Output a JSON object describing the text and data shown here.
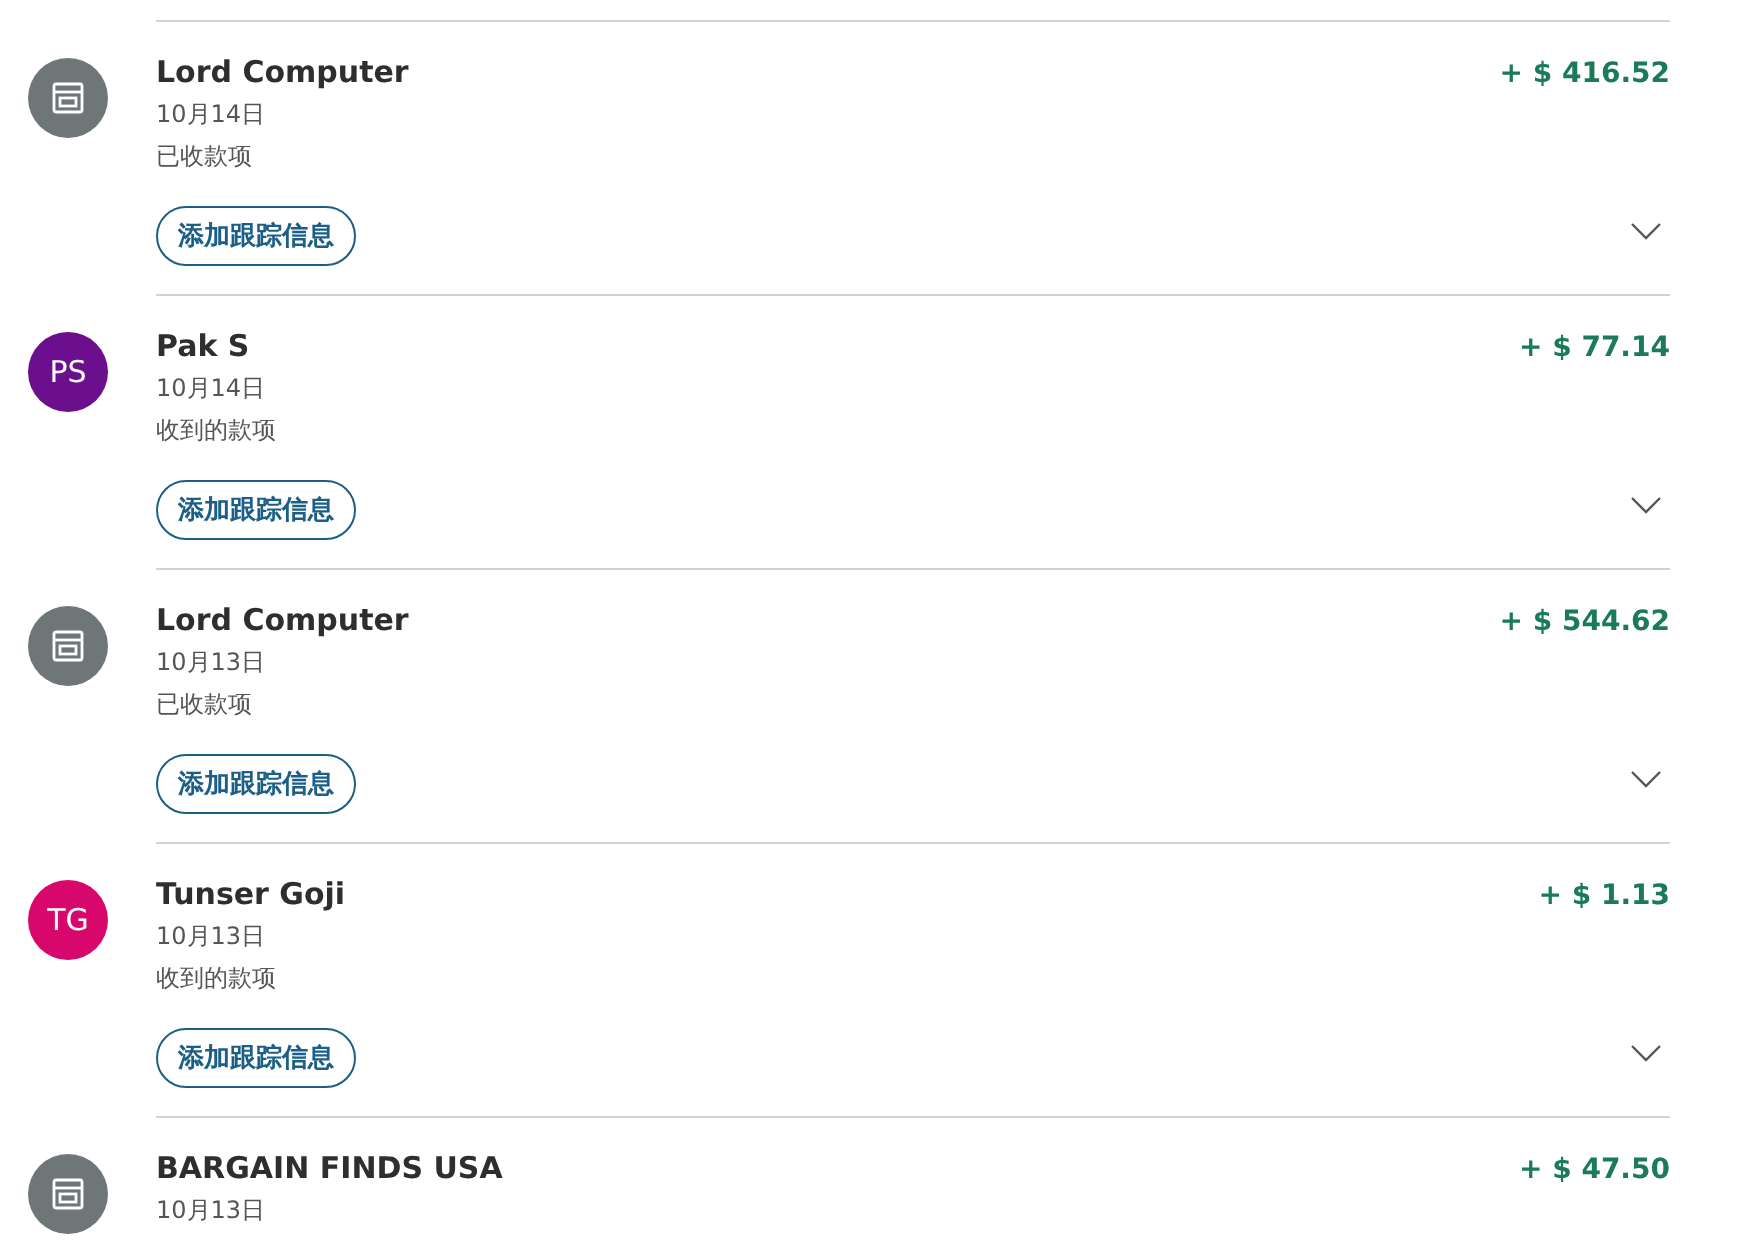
{
  "transactions": [
    {
      "avatar": {
        "kind": "store",
        "color": "#6e7678"
      },
      "name": "Lord Computer",
      "amount": "+ $ 416.52",
      "date": "10月14日",
      "status": "已收款项",
      "action": "添加跟踪信息"
    },
    {
      "avatar": {
        "kind": "initials",
        "text": "PS",
        "color": "#6b0f8e"
      },
      "name": "Pak S",
      "amount": "+ $ 77.14",
      "date": "10月14日",
      "status": "收到的款项",
      "action": "添加跟踪信息"
    },
    {
      "avatar": {
        "kind": "store",
        "color": "#6e7678"
      },
      "name": "Lord Computer",
      "amount": "+ $ 544.62",
      "date": "10月13日",
      "status": "已收款项",
      "action": "添加跟踪信息"
    },
    {
      "avatar": {
        "kind": "initials",
        "text": "TG",
        "color": "#d8076c"
      },
      "name": "Tunser Goji",
      "amount": "+ $ 1.13",
      "date": "10月13日",
      "status": "收到的款项",
      "action": "添加跟踪信息"
    },
    {
      "avatar": {
        "kind": "store",
        "color": "#6e7678"
      },
      "name": "BARGAIN FINDS USA",
      "amount": "+ $ 47.50",
      "date": "10月13日"
    }
  ]
}
